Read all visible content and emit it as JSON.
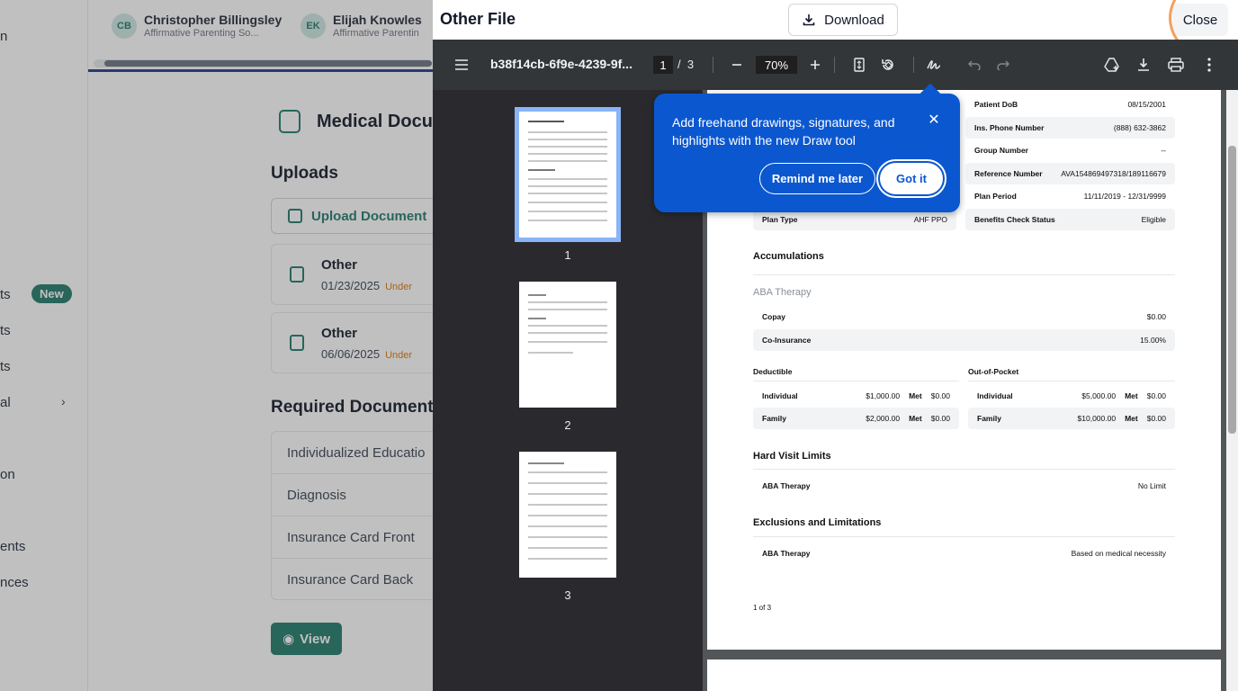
{
  "background": {
    "clients": [
      {
        "initials": "CB",
        "name": "Christopher Billingsley",
        "org": "Affirmative Parenting So..."
      },
      {
        "initials": "EK",
        "name": "Elijah Knowles",
        "org": "Affirmative Parentin"
      }
    ],
    "sidebar_fragments": [
      "n",
      "ts",
      "ts",
      "ts",
      "al",
      "on",
      "ents",
      "nces"
    ],
    "new_badge": "New",
    "page_title": "Medical Docu",
    "uploads_heading": "Uploads",
    "upload_button": "Upload Document",
    "uploads": [
      {
        "title": "Other",
        "date": "01/23/2025",
        "status": "Under"
      },
      {
        "title": "Other",
        "date": "06/06/2025",
        "status": "Under"
      }
    ],
    "required_heading": "Required Documents",
    "required_docs": [
      "Individualized Educatio",
      "Diagnosis",
      "Insurance Card Front",
      "Insurance Card Back"
    ],
    "view_button": "View"
  },
  "modal": {
    "title": "Other File",
    "download_label": "Download",
    "close_label": "Close",
    "viewer": {
      "file_name": "b38f14cb-6f9e-4239-9f...",
      "current_page": "1",
      "page_sep": "/",
      "total_pages": "3",
      "zoom": "70%",
      "thumb_numbers": [
        "1",
        "2",
        "3"
      ]
    },
    "popover": {
      "message": "Add freehand drawings, signatures, and highlights with the new Draw tool",
      "remind_label": "Remind me later",
      "got_it_label": "Got it"
    },
    "document": {
      "right_rows": [
        {
          "label": "Patient DoB",
          "value": "08/15/2001"
        },
        {
          "label": "Ins. Phone Number",
          "value": "(888) 632-3862"
        },
        {
          "label": "Group Number",
          "value": "--"
        },
        {
          "label": "Reference Number",
          "value": "AVA154869497318/189116679"
        },
        {
          "label": "Plan Period",
          "value": "11/11/2019 - 12/31/9999"
        },
        {
          "label": "Benefits Check Status",
          "value": "Eligible"
        }
      ],
      "plan_type": {
        "label": "Plan Type",
        "value": "AHF PPO"
      },
      "accumulations_heading": "Accumulations",
      "therapy_label": "ABA Therapy",
      "copay": {
        "label": "Copay",
        "value": "$0.00"
      },
      "coinsurance": {
        "label": "Co-Insurance",
        "value": "15.00%"
      },
      "deductible_heading": "Deductible",
      "oop_heading": "Out-of-Pocket",
      "met_label": "Met",
      "deductible_rows": [
        {
          "label": "Individual",
          "value": "$1,000.00",
          "met": "$0.00"
        },
        {
          "label": "Family",
          "value": "$2,000.00",
          "met": "$0.00"
        }
      ],
      "oop_rows": [
        {
          "label": "Individual",
          "value": "$5,000.00",
          "met": "$0.00"
        },
        {
          "label": "Family",
          "value": "$10,000.00",
          "met": "$0.00"
        }
      ],
      "visit_limits_heading": "Hard Visit Limits",
      "visit_limit": {
        "label": "ABA Therapy",
        "value": "No Limit"
      },
      "exclusions_heading": "Exclusions and Limitations",
      "exclusion": {
        "label": "ABA Therapy",
        "value": "Based on medical necessity"
      },
      "page_footer": "1 of 3"
    }
  },
  "colors": {
    "accent": "#1f7a6b",
    "popover_blue": "#0b57d0",
    "highlight_ring": "#f5a05a"
  }
}
